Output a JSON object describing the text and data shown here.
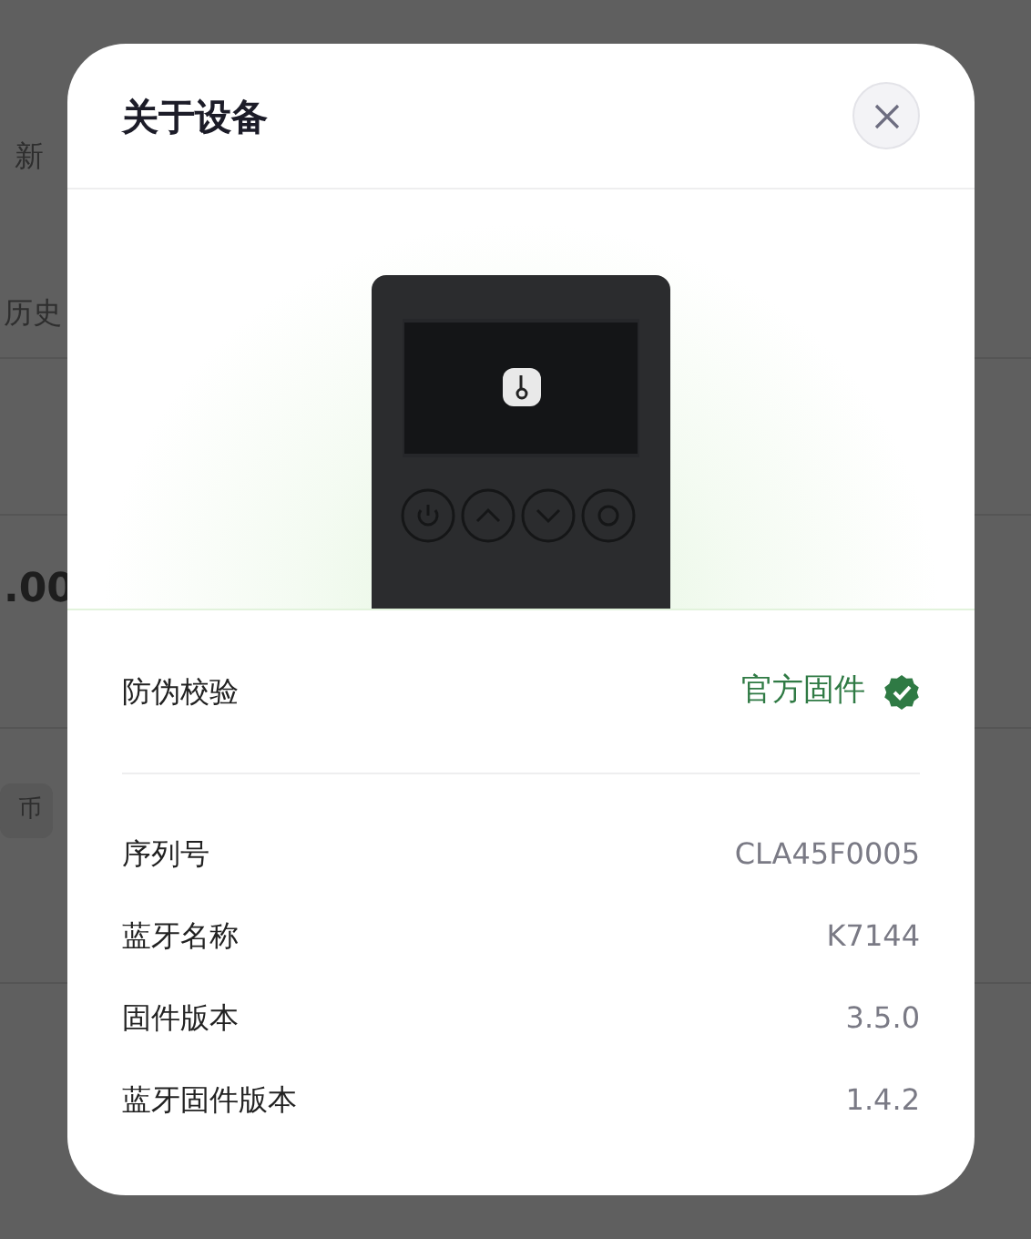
{
  "background": {
    "update_label": "新",
    "history_label": "历史",
    "amount": ".00",
    "currency_tag": "币"
  },
  "dialog": {
    "title": "关于设备",
    "verification": {
      "label": "防伪校验",
      "value": "官方固件",
      "verified": true
    },
    "details": [
      {
        "label": "序列号",
        "value": "CLA45F0005"
      },
      {
        "label": "蓝牙名称",
        "value": "K7144"
      },
      {
        "label": "固件版本",
        "value": "3.5.0"
      },
      {
        "label": "蓝牙固件版本",
        "value": "1.4.2"
      }
    ]
  }
}
